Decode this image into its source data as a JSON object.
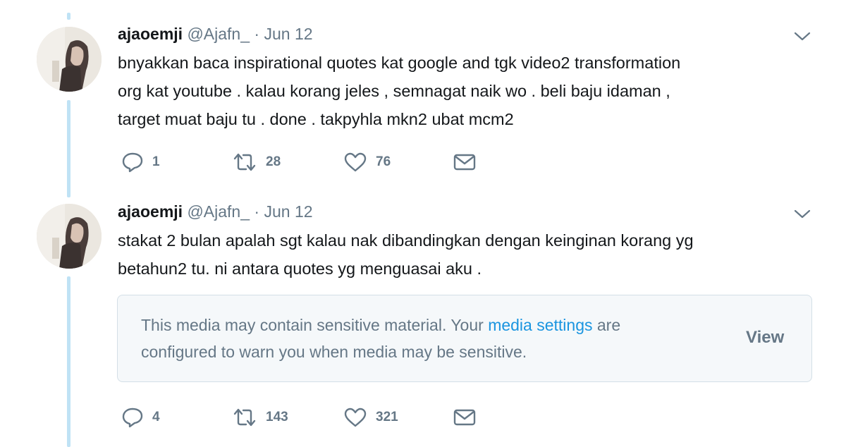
{
  "tweets": [
    {
      "author_name": "ajaoemji",
      "handle": "@Ajafn_",
      "separator": "·",
      "date": "Jun 12",
      "lines": [
        "bnyakkan baca inspirational quotes kat google and tgk video2 transformation",
        "org kat youtube . kalau korang jeles , semnagat naik wo . beli baju idaman ,",
        "target muat baju tu . done . takpyhla mkn2 ubat mcm2"
      ],
      "reply_count": "1",
      "retweet_count": "28",
      "like_count": "76",
      "icons": [
        "reply-icon",
        "retweet-icon",
        "like-icon",
        "direct-message-icon",
        "chevron-down-icon"
      ]
    },
    {
      "author_name": "ajaoemji",
      "handle": "@Ajafn_",
      "separator": "·",
      "date": "Jun 12",
      "lines": [
        "stakat 2 bulan apalah sgt kalau nak dibandingkan dengan keinginan korang yg",
        "betahun2 tu. ni antara quotes yg menguasai aku ."
      ],
      "sensitive_notice": {
        "text_before": "This media may contain sensitive material. Your ",
        "link_text": "media settings",
        "text_after": " are",
        "line2": "configured to warn you when media may be sensitive.",
        "view_label": "View"
      },
      "reply_count": "4",
      "retweet_count": "143",
      "like_count": "321",
      "icons": [
        "reply-icon",
        "retweet-icon",
        "like-icon",
        "direct-message-icon",
        "chevron-down-icon"
      ]
    }
  ],
  "colors": {
    "thread_line": "#bfe2f5",
    "link": "#1b95e0",
    "muted": "#657786",
    "text": "#14171a"
  }
}
